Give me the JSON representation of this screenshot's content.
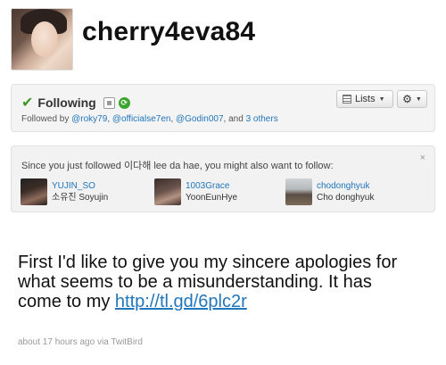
{
  "profile": {
    "screen_name": "cherry4eva84"
  },
  "follow_box": {
    "following_label": "Following",
    "followed_by_prefix": "Followed by",
    "followers": [
      "@roky79",
      "@officialse7en",
      "@Godin007"
    ],
    "sep1": ",",
    "sep2": ",",
    "and_text": ", and",
    "others_link": "3 others",
    "lists_button": "Lists",
    "icons": [
      "checkmark-icon",
      "device-icon",
      "retweet-icon",
      "lists-icon",
      "gear-icon"
    ]
  },
  "suggestions": {
    "intro": "Since you just followed 이다해 lee da hae, you might also want to follow:",
    "close": "×",
    "users": [
      {
        "handle": "YUJIN_SO",
        "name": "소유진 Soyujin"
      },
      {
        "handle": "1003Grace",
        "name": "YoonEunHye"
      },
      {
        "handle": "chodonghyuk",
        "name": "Cho donghyuk"
      }
    ]
  },
  "tweet": {
    "text": "First I'd like to give you my sincere apologies for what seems to be a misunderstanding. It has come to my",
    "link": "http://tl.gd/6plc2r",
    "time": "about 17 hours ago",
    "via_prefix": "via",
    "source": "TwitBird"
  },
  "colors": {
    "link": "#2276bb",
    "check": "#3d9a28",
    "retweet": "#3aa52c"
  }
}
